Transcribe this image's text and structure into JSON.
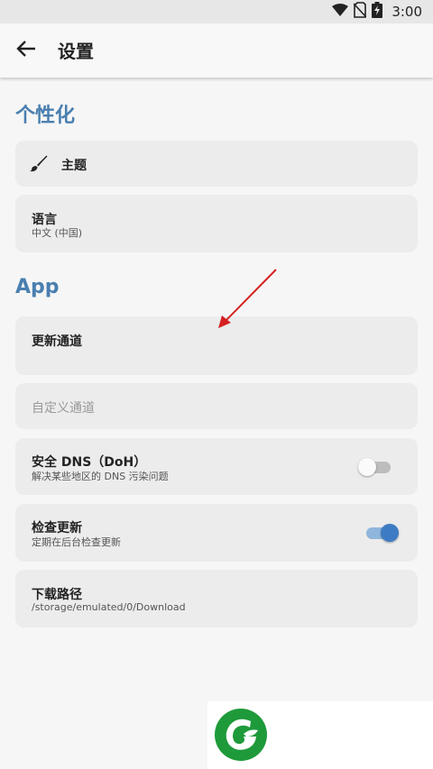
{
  "status_bar": {
    "time": "3:00",
    "icons": [
      "wifi-icon",
      "no-sim-icon",
      "battery-charging-icon"
    ]
  },
  "header": {
    "back_icon": "arrow-left-icon",
    "title": "设置"
  },
  "sections": {
    "personalization": {
      "title": "个性化"
    },
    "app": {
      "title": "App"
    }
  },
  "items": {
    "theme": {
      "icon": "brush-icon",
      "title": "主题"
    },
    "language": {
      "title": "语言",
      "value": "中文 (中国)"
    },
    "update_channel": {
      "title": "更新通道"
    },
    "custom_channel": {
      "title": "自定义通道",
      "enabled": false
    },
    "secure_dns": {
      "title": "安全 DNS（DoH）",
      "subtitle": "解决某些地区的 DNS 污染问题",
      "checked": false
    },
    "check_updates": {
      "title": "检查更新",
      "subtitle": "定期在后台检查更新",
      "checked": true
    },
    "download_path": {
      "title": "下载路径",
      "value": "/storage/emulated/0/Download"
    }
  },
  "colors": {
    "accent": "#4a7fb0",
    "toggle_on": "#3d7cc4",
    "annotation_arrow": "#d42020",
    "logo_green": "#1e9a3a"
  }
}
